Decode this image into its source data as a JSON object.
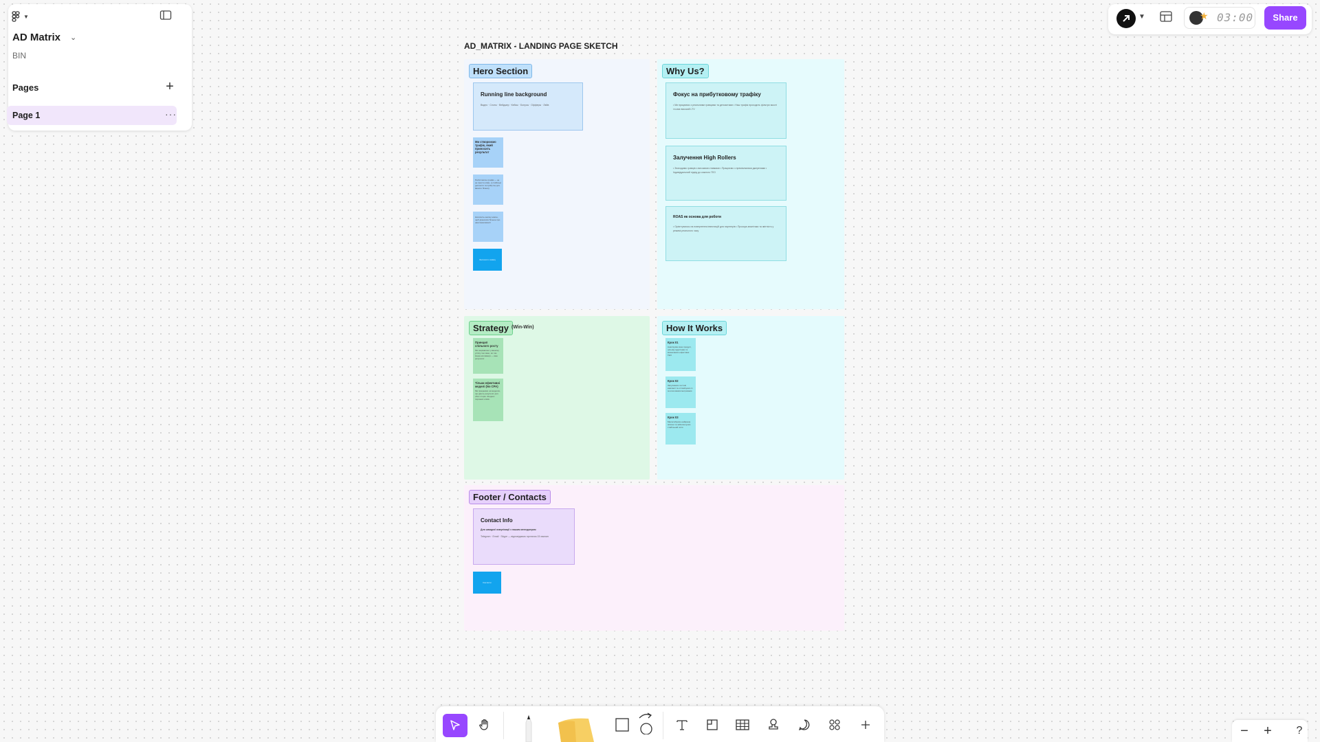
{
  "file": {
    "name": "AD Matrix",
    "team": "BIN"
  },
  "pages": {
    "label": "Pages",
    "items": [
      {
        "label": "Page 1"
      }
    ]
  },
  "topbar": {
    "timer": "03:00",
    "share_label": "Share"
  },
  "board": {
    "title": "AD_MATRIX - LANDING PAGE SKETCH",
    "sections": {
      "hero": {
        "label": "Hero Section",
        "card": {
          "title": "Running line background",
          "body": "Видео · Слоты · Вейджер · Кейсы · Бонусы · Офферы · Лайв"
        },
        "stickies": [
          {
            "title": "Ми створюємо трафік, який приносить результат",
            "body": ""
          },
          {
            "title": "",
            "body": "Performance-трафік — це не просто кліки, а стабільні депозити та прибуток для вашого бізнесу"
          },
          {
            "title": "",
            "body": "Натисніть кнопку нижче, щоб дізнатися більше про наші можливості"
          },
          {
            "title": "",
            "body": "Залишити заявку"
          }
        ]
      },
      "why": {
        "label": "Why Us?",
        "cards": [
          {
            "title": "Фокус  на  прибутковому  трафіку",
            "body": "• Ми працюємо з реальними гравцями та депозитами • Наш трафік проходить фільтри якості та має високий LTV"
          },
          {
            "title": "Залучення High Rollers",
            "body": "• Знаходимо гравців з високими ставками • Працюємо з преміальними джерелами • Індивідуальний підхід до кожного ГЕО"
          },
          {
            "title": "ROAS як основа для роботи",
            "body": "• Орієнтуємось на повернення інвестицій для партнерів • Прозора аналітика та звітність у режимі реального часу"
          }
        ]
      },
      "strategy": {
        "label": "Strategy",
        "sub": "(Win-Win)",
        "stickies": [
          {
            "title": "Принцип спільного росту",
            "body": "Ми зацікавлені у вашому успіху так само, як і ви. Наша мотивація — ваш результат."
          },
          {
            "title": "Тільки ефективні моделі (No CPA)",
            "body": "Ми працюємо на моделях, що дають результат для обох сторін. Жодних порожніх кліків."
          }
        ]
      },
      "how": {
        "label": "How It Works",
        "stickies": [
          {
            "title": "Крок 01",
            "body": "Аналізуємо ваш продукт, цільову аудиторію та визначаємо ефективні ГЕО"
          },
          {
            "title": "Крок 02",
            "body": "Запускаємо тестові кампанії та оптимізуємо їх за ключовими метриками"
          },
          {
            "title": "Крок 03",
            "body": "Масштабуємо найкращі зв'язки та забезпечуємо стабільний потік"
          }
        ]
      },
      "footer": {
        "label": "Footer / Contacts",
        "card": {
          "title": "Contact Info",
          "subtitle": "Для швидкої комунікації з нашим менеджером",
          "body": "Telegram · Email · Skype — відповідаємо протягом 15 хвилин"
        },
        "button": "Контакти"
      }
    }
  },
  "icons": {
    "logo": "figma-logo-icon",
    "sidebar": "sidebar-toggle-icon",
    "add": "plus-icon",
    "more": "more-horizontal-icon",
    "select": "cursor-icon",
    "hand": "hand-icon",
    "pencil": "pencil-icon",
    "sticky": "sticky-note-icon",
    "shape": "rectangle-icon",
    "connector": "arrow-icon",
    "text": "text-icon",
    "section": "section-icon",
    "table": "table-icon",
    "stamp": "stamp-icon",
    "comment": "comment-icon",
    "widgets": "widgets-icon",
    "more_tools": "plus-icon"
  },
  "colors": {
    "accent": "#9747ff"
  }
}
